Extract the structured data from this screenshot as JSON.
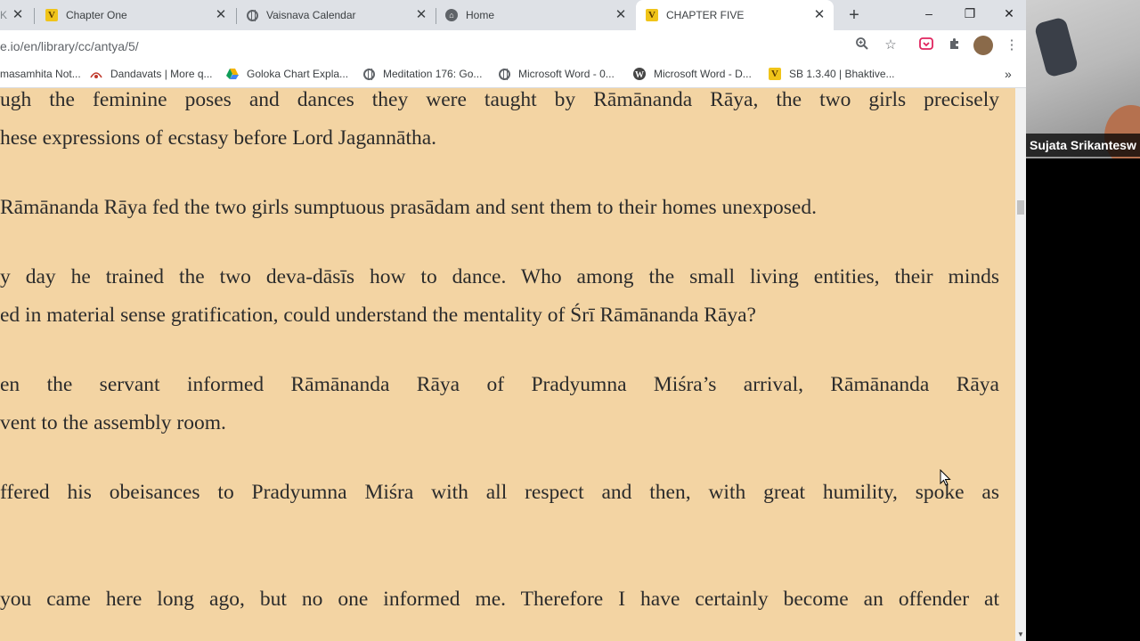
{
  "tabs": [
    {
      "label": "Chapter One",
      "icon": "v-icon"
    },
    {
      "label": "Vaisnava Calendar",
      "icon": "globe-icon"
    },
    {
      "label": "Home",
      "icon": "home-icon"
    },
    {
      "label": "CHAPTER FIVE",
      "icon": "v-icon"
    }
  ],
  "partial_tab_label": "K",
  "new_tab": "+",
  "window_controls": {
    "minimize": "–",
    "maximize": "❐",
    "close": "✕"
  },
  "address_bar": {
    "text": "e.io/en/library/cc/antya/5/"
  },
  "bookmarks": [
    {
      "label": "masamhita Not...",
      "icon": "none"
    },
    {
      "label": "Dandavats | More q...",
      "icon": "dandavats-icon"
    },
    {
      "label": "Goloka Chart Expla...",
      "icon": "drive-icon"
    },
    {
      "label": "Meditation 176: Go...",
      "icon": "globe-icon"
    },
    {
      "label": "Microsoft Word - 0...",
      "icon": "globe-icon"
    },
    {
      "label": "Microsoft Word - D...",
      "icon": "wordpress-icon"
    },
    {
      "label": "SB 1.3.40 | Bhaktive...",
      "icon": "v-icon"
    }
  ],
  "bookmarks_more": "»",
  "paragraphs": [
    {
      "lines": [
        "ugh the feminine poses and dances they were taught by Rāmānanda Rāya, the two girls precisely",
        "hese expressions of ecstasy before Lord Jagannātha."
      ]
    },
    {
      "lines": [
        "Rāmānanda Rāya fed the two girls sumptuous prasādam and sent them to their homes unexposed."
      ]
    },
    {
      "lines": [
        "y day he trained the two deva-dāsīs how to dance. Who among the small living entities, their minds",
        "ed in material sense gratification, could understand the mentality of Śrī Rāmānanda Rāya?"
      ]
    },
    {
      "lines": [
        "en the servant informed Rāmānanda Rāya of Pradyumna Miśra’s arrival, Rāmānanda Rāya",
        "vent to the assembly room."
      ]
    },
    {
      "lines": [
        "ffered his obeisances to Pradyumna Miśra with all respect and then, with great humility, spoke as"
      ]
    },
    {
      "lines": [
        "you came here long ago, but no one informed me. Therefore I have certainly become an offender at"
      ]
    }
  ],
  "participant": {
    "name": "Sujata Srikantesw"
  },
  "colors": {
    "page_bg": "#f3d4a3",
    "text": "#2b2b2b",
    "tabstrip": "#dee1e6",
    "v_brand": "#f0c419"
  }
}
